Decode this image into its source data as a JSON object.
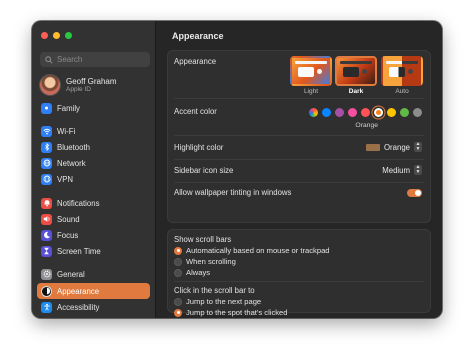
{
  "window": {
    "title": "Appearance"
  },
  "search": {
    "placeholder": "Search"
  },
  "profile": {
    "name": "Geoff Graham",
    "subtitle": "Apple ID"
  },
  "sidebar": {
    "items": [
      {
        "label": "Family",
        "icon": "family-icon"
      },
      {
        "label": "Wi-Fi",
        "icon": "wifi-icon"
      },
      {
        "label": "Bluetooth",
        "icon": "bluetooth-icon"
      },
      {
        "label": "Network",
        "icon": "network-icon"
      },
      {
        "label": "VPN",
        "icon": "vpn-icon"
      },
      {
        "label": "Notifications",
        "icon": "bell-icon"
      },
      {
        "label": "Sound",
        "icon": "speaker-icon"
      },
      {
        "label": "Focus",
        "icon": "moon-icon"
      },
      {
        "label": "Screen Time",
        "icon": "hourglass-icon"
      },
      {
        "label": "General",
        "icon": "gear-icon"
      },
      {
        "label": "Appearance",
        "icon": "appearance-icon",
        "active": true
      },
      {
        "label": "Accessibility",
        "icon": "accessibility-icon"
      }
    ]
  },
  "appearance": {
    "label": "Appearance",
    "options": [
      {
        "label": "Light",
        "selected": false
      },
      {
        "label": "Dark",
        "selected": true
      },
      {
        "label": "Auto",
        "selected": false
      }
    ]
  },
  "accent": {
    "label": "Accent color",
    "selected_label": "Orange",
    "colors": [
      "multicolor",
      "#0a84ff",
      "#a550a7",
      "#f74f9e",
      "#ff5257",
      "#f7821b",
      "#ffc600",
      "#62ba46",
      "#8c8c8c"
    ],
    "selected_index": 5
  },
  "highlight": {
    "label": "Highlight color",
    "value": "Orange",
    "chip_color": "#9a7049"
  },
  "sidebar_icon_size": {
    "label": "Sidebar icon size",
    "value": "Medium"
  },
  "wallpaper_tinting": {
    "label": "Allow wallpaper tinting in windows",
    "enabled": true
  },
  "scroll_bars": {
    "label": "Show scroll bars",
    "options": [
      {
        "label": "Automatically based on mouse or trackpad",
        "selected": true
      },
      {
        "label": "When scrolling",
        "selected": false
      },
      {
        "label": "Always",
        "selected": false
      }
    ]
  },
  "scroll_click": {
    "label": "Click in the scroll bar to",
    "options": [
      {
        "label": "Jump to the next page",
        "selected": false
      },
      {
        "label": "Jump to the spot that's clicked",
        "selected": true
      }
    ]
  },
  "colors": {
    "accent": "#e07a3f",
    "window_bg": "#262626",
    "sidebar_bg": "#333232"
  }
}
